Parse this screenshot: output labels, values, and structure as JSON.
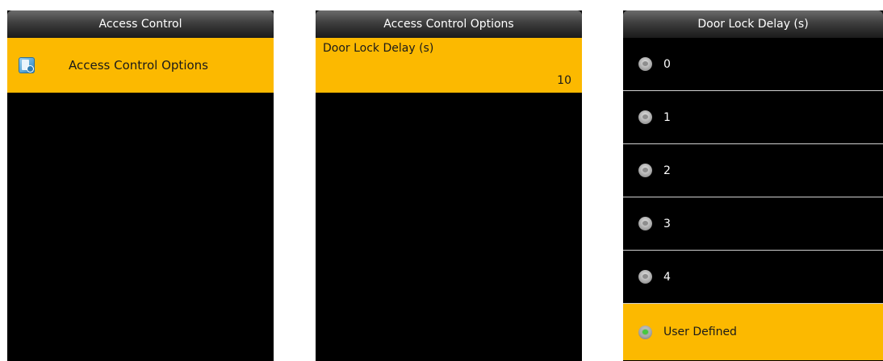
{
  "screen1": {
    "title": "Access Control",
    "items": [
      {
        "label": "Access Control Options",
        "icon": "access-control-icon",
        "selected": true
      }
    ]
  },
  "screen2": {
    "title": "Access Control Options",
    "items": [
      {
        "label": "Door Lock Delay (s)",
        "value": "10",
        "selected": true
      }
    ]
  },
  "screen3": {
    "title": "Door Lock Delay (s)",
    "options": [
      {
        "label": "0",
        "selected": false
      },
      {
        "label": "1",
        "selected": false
      },
      {
        "label": "2",
        "selected": false
      },
      {
        "label": "3",
        "selected": false
      },
      {
        "label": "4",
        "selected": false
      },
      {
        "label": "User Defined",
        "selected": true
      }
    ]
  },
  "colors": {
    "highlight": "#fcb900",
    "background": "#000000",
    "selected_radio": "#47c93e"
  }
}
